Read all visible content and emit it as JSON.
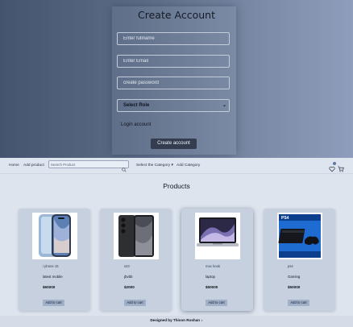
{
  "signup": {
    "title": "Create Account",
    "fullname_placeholder": "Enter fullname",
    "email_placeholder": "Enter Email",
    "password_placeholder": "create password",
    "role_selected": "Select Role",
    "login_link": "Login account",
    "create_button": "Create account"
  },
  "navbar": {
    "home": "Home",
    "add_product": "Add product",
    "search_placeholder": "Search Product",
    "category_select": "Select the Category",
    "add_category": "Add Category",
    "icons": [
      "search-icon",
      "wishlist-icon",
      "cart-icon"
    ]
  },
  "products": {
    "title": "Products",
    "add_to_cart": "Add to cart",
    "items": [
      {
        "brand": "i phone 15",
        "name": "latest mobile",
        "price": "$60000",
        "image": "iphone-image"
      },
      {
        "brand": "s23",
        "name": "jbvbb",
        "price": "$2000",
        "image": "galaxy-phone-image"
      },
      {
        "brand": "mac book",
        "name": "laptop",
        "price": "$50000",
        "image": "macbook-image"
      },
      {
        "brand": "ps4",
        "name": "Gaming",
        "price": "$50000",
        "image": "ps4-image"
      }
    ]
  },
  "footer": {
    "text": "Designed by Thivon Roshan ♪"
  },
  "colors": {
    "hero_gradient_start": "#44546f",
    "hero_gradient_end": "#8d9dbb",
    "create_button": "#333d4f",
    "cart_button": "#9fb0c8",
    "card_background": "#c7d0de",
    "page_background": "#dde4ee"
  }
}
